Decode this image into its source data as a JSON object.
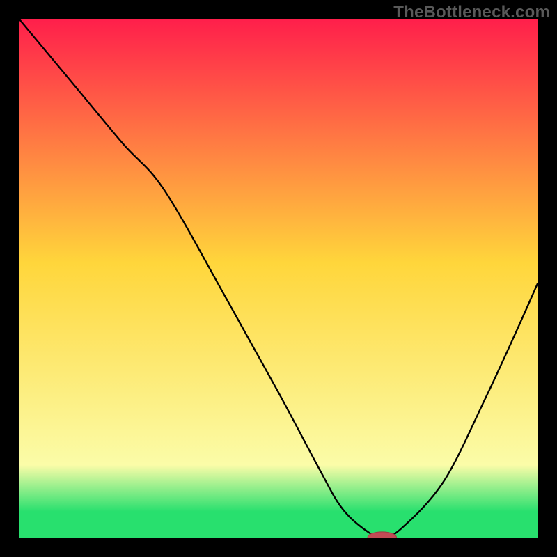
{
  "watermark": "TheBottleneck.com",
  "colors": {
    "page_bg": "#000000",
    "plot_bg": "#ffffff",
    "curve": "#000000",
    "marker_fill": "#c14b55",
    "marker_stroke": "#9e3b44",
    "grad_top": "#ff1f4b",
    "grad_yellow": "#ffd63b",
    "grad_pale": "#fbfca8",
    "grad_green": "#28e06e",
    "grad_bottom": "#28e06e"
  },
  "chart_data": {
    "type": "line",
    "title": "",
    "xlabel": "",
    "ylabel": "",
    "xlim": [
      0,
      100
    ],
    "ylim": [
      0,
      100
    ],
    "series": [
      {
        "name": "bottleneck-curve",
        "x": [
          0,
          10,
          20,
          28,
          40,
          50,
          58,
          62,
          66,
          70,
          74,
          82,
          90,
          96,
          100
        ],
        "y": [
          100,
          88,
          76,
          67,
          46,
          28,
          13,
          6,
          2,
          0,
          2,
          11,
          27,
          40,
          49
        ]
      }
    ],
    "marker": {
      "x": 70,
      "y": 0,
      "rx": 2.8,
      "ry": 1.1
    },
    "gradient_stops": [
      {
        "pct": 0,
        "color_key": "grad_top"
      },
      {
        "pct": 47,
        "color_key": "grad_yellow"
      },
      {
        "pct": 86,
        "color_key": "grad_pale"
      },
      {
        "pct": 95,
        "color_key": "grad_green"
      },
      {
        "pct": 100,
        "color_key": "grad_bottom"
      }
    ]
  }
}
